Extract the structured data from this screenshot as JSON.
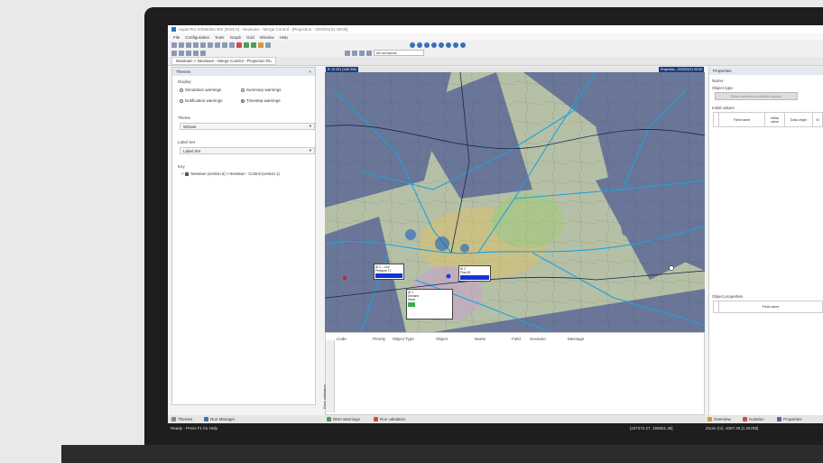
{
  "window": {
    "title": "Aquis Pro InfoWorks WS [2020.0] - Newtown - Merge Control - [Projection - 2020/01/21 00:00]"
  },
  "menu": [
    "File",
    "Configuration",
    "Tools",
    "Graph",
    "Grid",
    "Window",
    "Help"
  ],
  "toolbar": {
    "scenario_combo": "All scenarios"
  },
  "document_tab": "Newtown > Newtown - Merge Control - Projection Ru",
  "themes_panel": {
    "title": "Themes",
    "display_label": "Display",
    "radios": [
      {
        "label": "Simulation warnings",
        "selected": false
      },
      {
        "label": "Summary warnings",
        "selected": false
      },
      {
        "label": "Notification warnings",
        "selected": false
      },
      {
        "label": "Timestep warnings",
        "selected": true
      }
    ],
    "theme_label": "Theme",
    "theme_value": "WSave",
    "labelset_label": "Label Set",
    "labelset_value": "Label Set",
    "key_label": "Key",
    "tree_item": "Newtown (version 5) > Newtown - Control (version 1)"
  },
  "map": {
    "stamp_left": "R: 12 001 (1:60 000)",
    "stamp_right": "Projection - 2020/01/21 00:00"
  },
  "messages": {
    "columns": [
      "Code",
      "Priority",
      "Object Type",
      "Object",
      "Name",
      "Field",
      "Scenario",
      "Message"
    ],
    "side_tab": "Error validation"
  },
  "properties_panel": {
    "title": "Properties",
    "name_label": "Name:",
    "object_type_label": "Object type:",
    "select_button": "Select selected controlled objects",
    "initial_values_label": "Initial values",
    "initial_columns": [
      "Field name",
      "Initial value",
      "Data origin",
      "M"
    ],
    "object_props_label": "Object properties",
    "object_columns": [
      "Field name"
    ]
  },
  "bottom_tabs": {
    "left": [
      "Themes",
      "Run Manager"
    ],
    "middle": [
      "DMA Warnings",
      "Run validation"
    ],
    "right": [
      "Overview",
      "Isolation",
      "Properties"
    ]
  },
  "status": {
    "left": "Ready - Press F1 for Help",
    "coords": "[437372.27, 159601.38]",
    "zoom": "Zoom (m): 4007.49 [1:26788]"
  },
  "colors": {
    "accent": "#1c3c7a",
    "map_overlay": "#2c3a8c",
    "pipe": "#1aa3e0"
  }
}
